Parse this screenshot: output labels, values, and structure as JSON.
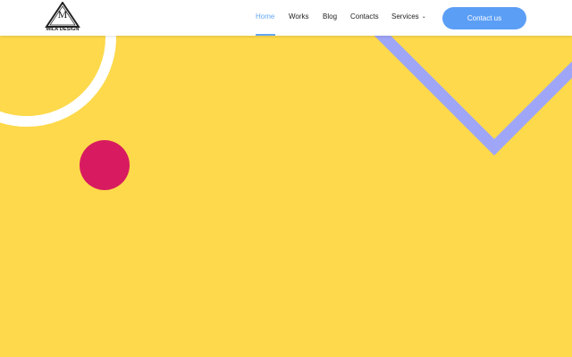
{
  "brand": {
    "letter": "M",
    "name": "MILA DESIGN",
    "logo_icon": "triangle-logo-icon"
  },
  "nav": {
    "items": [
      {
        "label": "Home",
        "active": true
      },
      {
        "label": "Works",
        "active": false
      },
      {
        "label": "Blog",
        "active": false
      },
      {
        "label": "Contacts",
        "active": false
      },
      {
        "label": "Services",
        "active": false,
        "icon": "chevron-down-icon"
      }
    ],
    "cta_label": "Contact us"
  },
  "colors": {
    "background": "#FDD94B",
    "accent": "#5B9EF6",
    "active_link": "#64A7F5",
    "circle": "#D81B60",
    "chevron_shape": "#9FA6F7",
    "ring": "#FFFFFF"
  }
}
